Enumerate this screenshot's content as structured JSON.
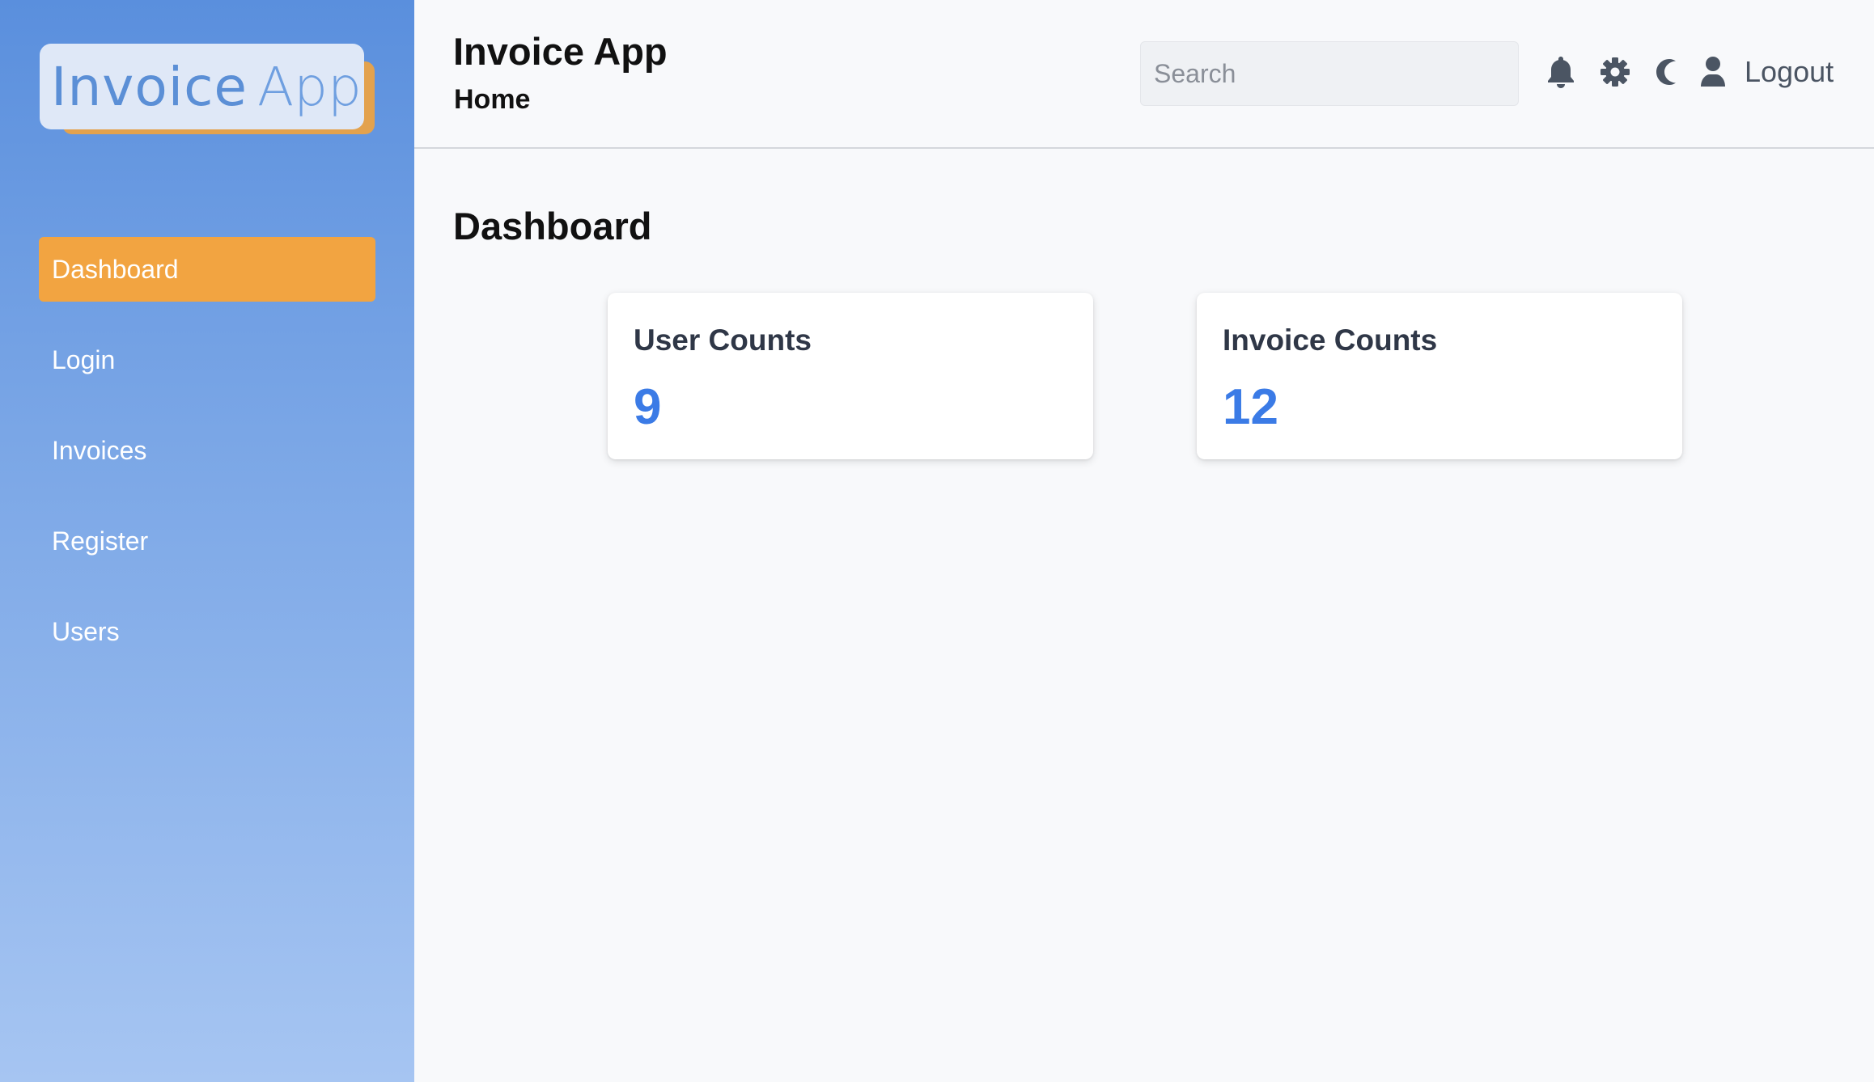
{
  "sidebar": {
    "logo": {
      "word1": "Invoice",
      "word2": "App"
    },
    "items": [
      {
        "label": "Dashboard",
        "active": true
      },
      {
        "label": "Login",
        "active": false
      },
      {
        "label": "Invoices",
        "active": false
      },
      {
        "label": "Register",
        "active": false
      },
      {
        "label": "Users",
        "active": false
      }
    ]
  },
  "header": {
    "title": "Invoice App",
    "breadcrumb": "Home",
    "search": {
      "placeholder": "Search",
      "value": ""
    },
    "icons": [
      "bell-icon",
      "gear-icon",
      "moon-icon",
      "user-icon"
    ],
    "logout_label": "Logout"
  },
  "main": {
    "page_title": "Dashboard",
    "cards": [
      {
        "title": "User Counts",
        "value": "9"
      },
      {
        "title": "Invoice Counts",
        "value": "12"
      }
    ]
  },
  "colors": {
    "sidebar_top": "#5a8fdd",
    "sidebar_bottom": "#a6c5f2",
    "active_item": "#f2a441",
    "stat_value": "#3b7be6",
    "icon": "#4b5563"
  }
}
